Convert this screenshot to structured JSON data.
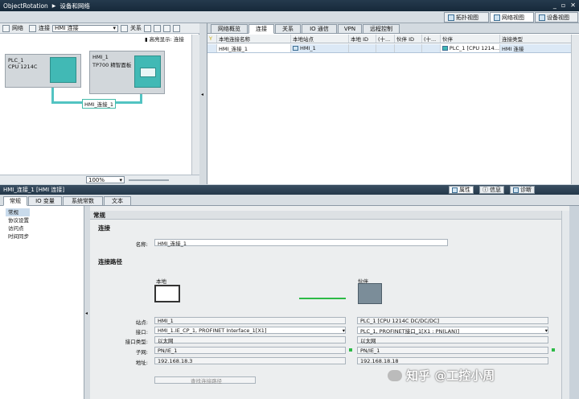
{
  "title": {
    "app": "ObjectRotation",
    "section": "设备和网络"
  },
  "views": [
    {
      "label": "拓扑视图",
      "icon": "topology-icon"
    },
    {
      "label": "网络视图",
      "icon": "network-icon"
    },
    {
      "label": "设备视图",
      "icon": "device-icon"
    }
  ],
  "left_toolbar": {
    "network_label": "网络",
    "connection_label": "连接",
    "connection_select": "HMI 连接",
    "relation_label": "关系"
  },
  "highlight": "高亮显示: 连接",
  "devices": [
    {
      "name": "PLC_1",
      "type": "CPU 1214C"
    },
    {
      "name": "HMI_1",
      "type": "TP700 精智面板"
    }
  ],
  "connection_label": "HMI_连接_1",
  "zoom": "100%",
  "right_tabs": [
    "网络概览",
    "连接",
    "关系",
    "IO 通信",
    "VPN",
    "远程控制"
  ],
  "table": {
    "headers": [
      "本地连接名称",
      "本地站点",
      "本地 ID",
      "(十...",
      "伙伴 ID",
      "(十...",
      "伙伴",
      "连接类型"
    ],
    "rows": [
      [
        "HMI_连接_1",
        "HMI_1",
        "",
        "",
        "",
        "",
        "PLC_1 [CPU 1214...",
        "HMI 连接"
      ]
    ]
  },
  "props": {
    "title": "HMI_连接_1 [HMI 连接]",
    "tabs": [
      "属性",
      "信息",
      "诊断"
    ],
    "subtabs": [
      "常规",
      "IO 变量",
      "系统常数",
      "文本"
    ],
    "nav": [
      "常规",
      "协议设置",
      "访问点",
      "时间同步"
    ],
    "section": "常规",
    "connection": {
      "heading": "连接",
      "name_label": "名称:",
      "name_value": "HMI_连接_1"
    },
    "path": {
      "heading": "连接路径",
      "local_label": "本地",
      "partner_label": "伙伴",
      "rows": [
        {
          "label": "站点:",
          "local": "HMI_1",
          "partner": "PLC_1 [CPU 1214C DC/DC/DC]"
        },
        {
          "label": "接口:",
          "local": "HMI_1.IE_CP_1, PROFINET Interface_1[X1]",
          "partner": "PLC_1, PROFINET接口_1[X1 : PN(LAN)]"
        },
        {
          "label": "接口类型:",
          "local": "以太网",
          "partner": "以太网"
        },
        {
          "label": "子网:",
          "local": "PN/IE_1",
          "partner": "PN/IE_1"
        },
        {
          "label": "地址:",
          "local": "192.168.18.3",
          "partner": "192.168.18.18"
        }
      ],
      "find_button": "查找连接路径"
    }
  },
  "watermark": "知乎 @工控小周",
  "colors": {
    "accent": "#52c3c2",
    "selection": "#dce9f6",
    "green": "#2cba46"
  }
}
